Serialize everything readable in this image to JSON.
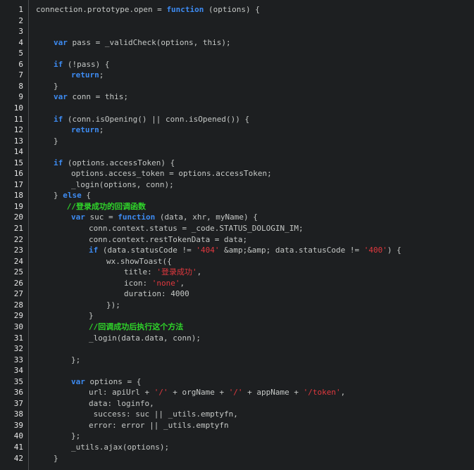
{
  "colors": {
    "background": "#1d1f21",
    "text": "#c5c8c6",
    "keyword": "#3d8bf2",
    "string": "#e0383e",
    "comment": "#2fd62a",
    "line_number": "#e6e6e6",
    "gutter_border": "#4a4c4f"
  },
  "lines": [
    {
      "n": "1",
      "indent": 0,
      "tokens": [
        {
          "t": "txt",
          "v": "connection.prototype.open = "
        },
        {
          "t": "kw",
          "v": "function"
        },
        {
          "t": "txt",
          "v": " (options) {"
        }
      ]
    },
    {
      "n": "2",
      "indent": 0,
      "tokens": []
    },
    {
      "n": "3",
      "indent": 0,
      "tokens": []
    },
    {
      "n": "4",
      "indent": 1,
      "tokens": [
        {
          "t": "kw",
          "v": "var"
        },
        {
          "t": "txt",
          "v": " pass = _validCheck(options, this);"
        }
      ]
    },
    {
      "n": "5",
      "indent": 0,
      "tokens": []
    },
    {
      "n": "6",
      "indent": 1,
      "tokens": [
        {
          "t": "kw",
          "v": "if"
        },
        {
          "t": "txt",
          "v": " (!pass) {"
        }
      ]
    },
    {
      "n": "7",
      "indent": 2,
      "tokens": [
        {
          "t": "kw",
          "v": "return"
        },
        {
          "t": "txt",
          "v": ";"
        }
      ]
    },
    {
      "n": "8",
      "indent": 1,
      "tokens": [
        {
          "t": "txt",
          "v": "}"
        }
      ]
    },
    {
      "n": "9",
      "indent": 1,
      "tokens": [
        {
          "t": "kw",
          "v": "var"
        },
        {
          "t": "txt",
          "v": " conn = this;"
        }
      ]
    },
    {
      "n": "10",
      "indent": 0,
      "tokens": []
    },
    {
      "n": "11",
      "indent": 1,
      "tokens": [
        {
          "t": "kw",
          "v": "if"
        },
        {
          "t": "txt",
          "v": " (conn.isOpening() || conn.isOpened()) {"
        }
      ]
    },
    {
      "n": "12",
      "indent": 2,
      "tokens": [
        {
          "t": "kw",
          "v": "return"
        },
        {
          "t": "txt",
          "v": ";"
        }
      ]
    },
    {
      "n": "13",
      "indent": 1,
      "tokens": [
        {
          "t": "txt",
          "v": "}"
        }
      ]
    },
    {
      "n": "14",
      "indent": 0,
      "tokens": []
    },
    {
      "n": "15",
      "indent": 1,
      "tokens": [
        {
          "t": "kw",
          "v": "if"
        },
        {
          "t": "txt",
          "v": " (options.accessToken) {"
        }
      ]
    },
    {
      "n": "16",
      "indent": 2,
      "tokens": [
        {
          "t": "txt",
          "v": "options.access_token = options.accessToken;"
        }
      ]
    },
    {
      "n": "17",
      "indent": 2,
      "tokens": [
        {
          "t": "txt",
          "v": "_login(options, conn);"
        }
      ]
    },
    {
      "n": "18",
      "indent": 1,
      "tokens": [
        {
          "t": "txt",
          "v": "} "
        },
        {
          "t": "kw",
          "v": "else"
        },
        {
          "t": "txt",
          "v": " {"
        }
      ]
    },
    {
      "n": "19",
      "indent": 1.75,
      "tokens": [
        {
          "t": "cmt",
          "v": "//登录成功的回调函数"
        }
      ]
    },
    {
      "n": "20",
      "indent": 2,
      "tokens": [
        {
          "t": "kw",
          "v": "var"
        },
        {
          "t": "txt",
          "v": " suc = "
        },
        {
          "t": "kw",
          "v": "function"
        },
        {
          "t": "txt",
          "v": " (data, xhr, myName) {"
        }
      ]
    },
    {
      "n": "21",
      "indent": 3,
      "tokens": [
        {
          "t": "txt",
          "v": "conn.context.status = _code.STATUS_DOLOGIN_IM;"
        }
      ]
    },
    {
      "n": "22",
      "indent": 3,
      "tokens": [
        {
          "t": "txt",
          "v": "conn.context.restTokenData = data;"
        }
      ]
    },
    {
      "n": "23",
      "indent": 3,
      "tokens": [
        {
          "t": "kw",
          "v": "if"
        },
        {
          "t": "txt",
          "v": " (data.statusCode != "
        },
        {
          "t": "str",
          "v": "'404'"
        },
        {
          "t": "txt",
          "v": " &amp;&amp; data.statusCode != "
        },
        {
          "t": "str",
          "v": "'400'"
        },
        {
          "t": "txt",
          "v": ") {"
        }
      ]
    },
    {
      "n": "24",
      "indent": 4,
      "tokens": [
        {
          "t": "txt",
          "v": "wx.showToast({"
        }
      ]
    },
    {
      "n": "25",
      "indent": 5,
      "tokens": [
        {
          "t": "txt",
          "v": "title: "
        },
        {
          "t": "str",
          "v": "'登录成功'"
        },
        {
          "t": "txt",
          "v": ","
        }
      ]
    },
    {
      "n": "26",
      "indent": 5,
      "tokens": [
        {
          "t": "txt",
          "v": "icon: "
        },
        {
          "t": "str",
          "v": "'none'"
        },
        {
          "t": "txt",
          "v": ","
        }
      ]
    },
    {
      "n": "27",
      "indent": 5,
      "tokens": [
        {
          "t": "txt",
          "v": "duration: 4000"
        }
      ]
    },
    {
      "n": "28",
      "indent": 4,
      "tokens": [
        {
          "t": "txt",
          "v": "});"
        }
      ]
    },
    {
      "n": "29",
      "indent": 3,
      "tokens": [
        {
          "t": "txt",
          "v": "}"
        }
      ]
    },
    {
      "n": "30",
      "indent": 3,
      "tokens": [
        {
          "t": "cmt",
          "v": "//回调成功后执行这个方法"
        }
      ]
    },
    {
      "n": "31",
      "indent": 3,
      "tokens": [
        {
          "t": "txt",
          "v": "_login(data.data, conn);"
        }
      ]
    },
    {
      "n": "32",
      "indent": 0,
      "tokens": []
    },
    {
      "n": "33",
      "indent": 2,
      "tokens": [
        {
          "t": "txt",
          "v": "};"
        }
      ]
    },
    {
      "n": "34",
      "indent": 0,
      "tokens": []
    },
    {
      "n": "35",
      "indent": 2,
      "tokens": [
        {
          "t": "kw",
          "v": "var"
        },
        {
          "t": "txt",
          "v": " options = {"
        }
      ]
    },
    {
      "n": "36",
      "indent": 3,
      "tokens": [
        {
          "t": "txt",
          "v": "url: apiUrl + "
        },
        {
          "t": "str",
          "v": "'/'"
        },
        {
          "t": "txt",
          "v": " + orgName + "
        },
        {
          "t": "str",
          "v": "'/'"
        },
        {
          "t": "txt",
          "v": " + appName + "
        },
        {
          "t": "str",
          "v": "'/token'"
        },
        {
          "t": "txt",
          "v": ","
        }
      ]
    },
    {
      "n": "37",
      "indent": 3,
      "tokens": [
        {
          "t": "txt",
          "v": "data: loginfo,"
        }
      ]
    },
    {
      "n": "38",
      "indent": 3,
      "tokens": [
        {
          "t": "txt",
          "v": " success: suc || _utils.emptyfn,"
        }
      ]
    },
    {
      "n": "39",
      "indent": 3,
      "tokens": [
        {
          "t": "txt",
          "v": "error: error || _utils.emptyfn"
        }
      ]
    },
    {
      "n": "40",
      "indent": 2,
      "tokens": [
        {
          "t": "txt",
          "v": "};"
        }
      ]
    },
    {
      "n": "41",
      "indent": 2,
      "tokens": [
        {
          "t": "txt",
          "v": "_utils.ajax(options);"
        }
      ]
    },
    {
      "n": "42",
      "indent": 1,
      "tokens": [
        {
          "t": "txt",
          "v": "}"
        }
      ]
    }
  ]
}
